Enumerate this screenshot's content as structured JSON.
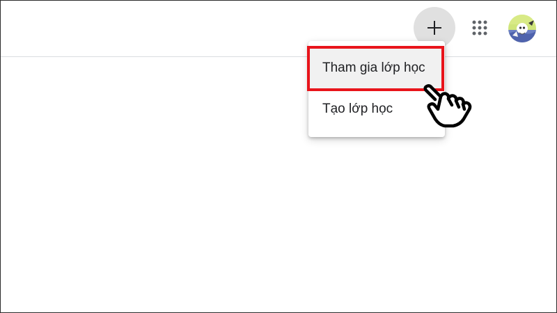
{
  "header": {
    "add_icon": "plus-icon",
    "apps_icon": "apps-grid-icon",
    "avatar_icon": "user-avatar"
  },
  "menu": {
    "items": [
      {
        "label": "Tham gia lớp học",
        "highlighted": true
      },
      {
        "label": "Tạo lớp học",
        "highlighted": false
      }
    ]
  },
  "annotation": {
    "highlight_color": "#e8141b",
    "cursor_icon": "pointing-hand-cursor-icon"
  },
  "colors": {
    "add_button_bg": "#e0e0e0",
    "icon_color": "#3c4043",
    "divider": "#dadce0",
    "menu_hover_bg": "#f1f1f1"
  }
}
